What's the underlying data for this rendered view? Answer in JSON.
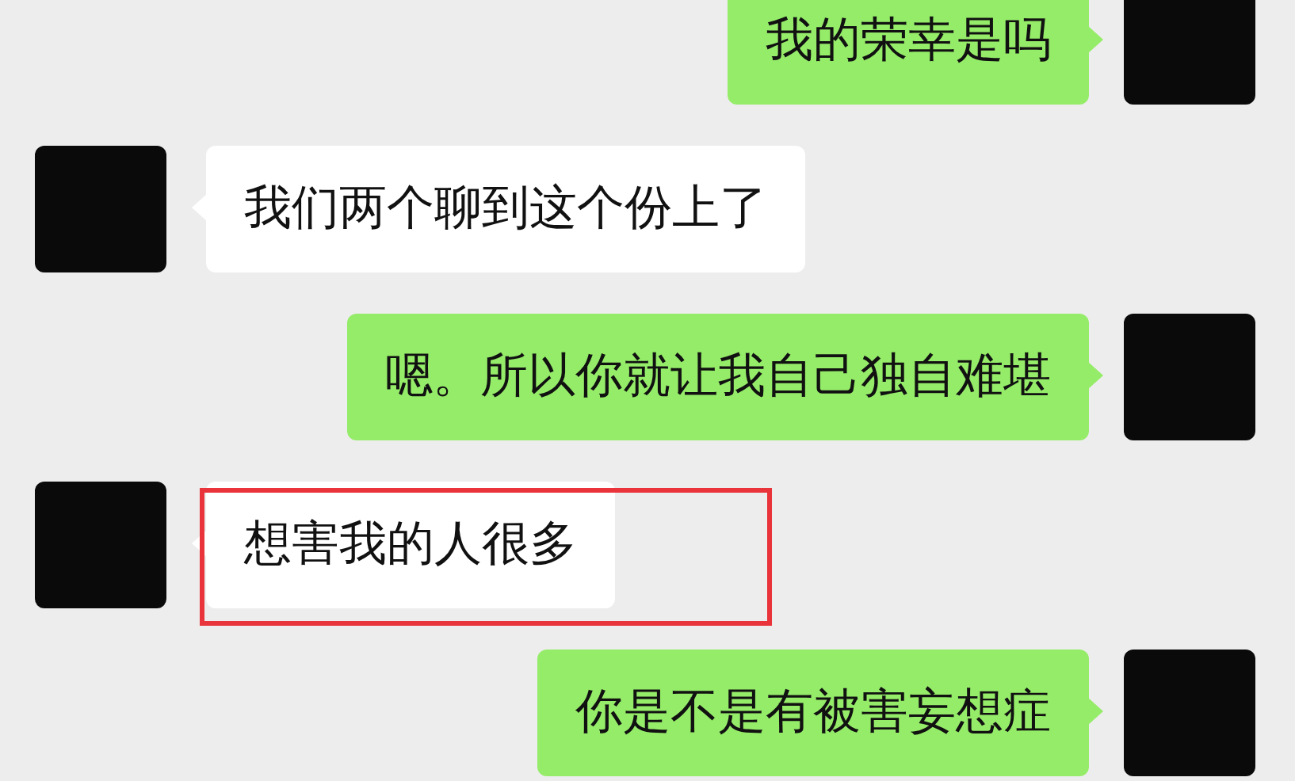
{
  "messages": [
    {
      "kind": "sent",
      "text": "我的荣幸是吗",
      "highlighted": false
    },
    {
      "kind": "received",
      "text": "我们两个聊到这个份上了",
      "highlighted": false
    },
    {
      "kind": "sent",
      "text": "嗯。所以你就让我自己独自难堪",
      "highlighted": false
    },
    {
      "kind": "received",
      "text": "想害我的人很多",
      "highlighted": true
    },
    {
      "kind": "sent",
      "text": "你是不是有被害妄想症",
      "highlighted": false
    }
  ]
}
